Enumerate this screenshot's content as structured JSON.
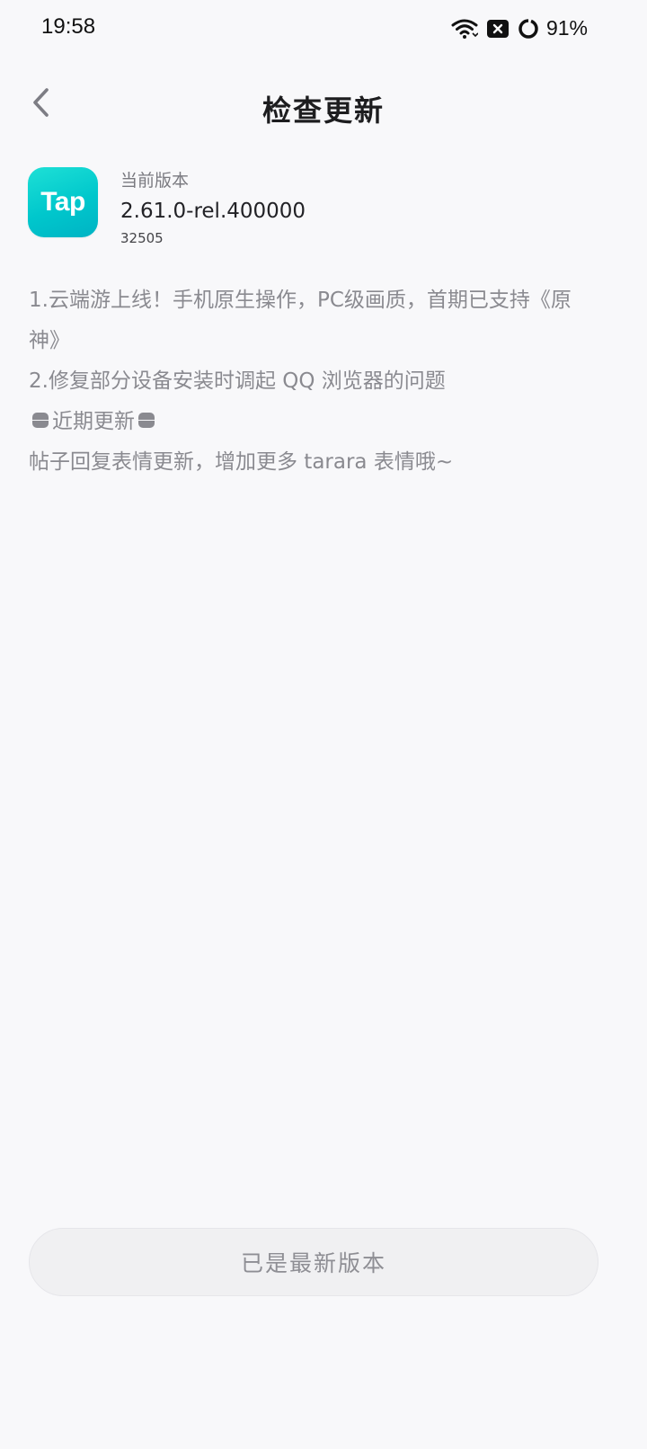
{
  "status_bar": {
    "time": "19:58",
    "battery_percent": "91%",
    "icons": [
      "wifi-icon",
      "notification-x-icon",
      "battery-ring-icon"
    ]
  },
  "header": {
    "title": "检查更新",
    "back_icon": "chevron-left-icon"
  },
  "app": {
    "logo_text": "Tap",
    "version_label": "当前版本",
    "version": "2.61.0-rel.400000",
    "build": "32505"
  },
  "release_notes": {
    "line1": "1.云端游上线！手机原生操作，PC级画质，首期已支持《原神》",
    "line2": "2.修复部分设备安装时调起 QQ 浏览器的问题",
    "recent_heading": "近期更新",
    "line3": "帖子回复表情更新，增加更多 tarara 表情哦~"
  },
  "footer": {
    "button_label": "已是最新版本"
  },
  "colors": {
    "background": "#f8f8fa",
    "brand_teal": "#00c7cc",
    "muted_text": "#8a8a90",
    "title_text": "#1d1d1f"
  }
}
